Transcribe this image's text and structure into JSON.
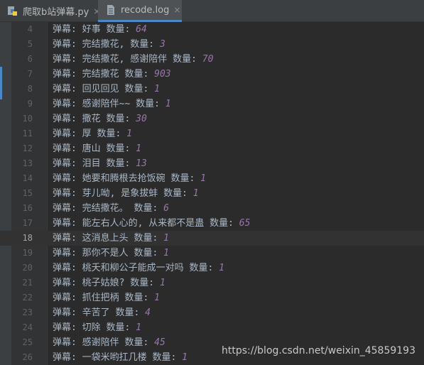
{
  "tabs": [
    {
      "label": "爬取b站弹幕.py",
      "icon": "python-file-icon",
      "active": false
    },
    {
      "label": "recode.log",
      "icon": "log-file-icon",
      "active": true
    }
  ],
  "close_glyph": "×",
  "current_line": "18",
  "lines": [
    {
      "num": "4",
      "text": "弹幕: 好事 数量: ",
      "count": "64"
    },
    {
      "num": "5",
      "text": "弹幕: 完结撒花, 数量: ",
      "count": "3"
    },
    {
      "num": "6",
      "text": "弹幕: 完结撒花, 感谢陪伴 数量: ",
      "count": "70"
    },
    {
      "num": "7",
      "text": "弹幕: 完结撒花 数量: ",
      "count": "903"
    },
    {
      "num": "8",
      "text": "弹幕: 回见回见 数量: ",
      "count": "1"
    },
    {
      "num": "9",
      "text": "弹幕: 感谢陪伴~~ 数量: ",
      "count": "1"
    },
    {
      "num": "10",
      "text": "弹幕: 撒花 数量: ",
      "count": "30"
    },
    {
      "num": "11",
      "text": "弹幕: 厚 数量: ",
      "count": "1"
    },
    {
      "num": "12",
      "text": "弹幕: 唐山 数量: ",
      "count": "1"
    },
    {
      "num": "13",
      "text": "弹幕: 泪目 数量: ",
      "count": "13"
    },
    {
      "num": "14",
      "text": "弹幕: 她要和腾根去抢饭碗 数量: ",
      "count": "1"
    },
    {
      "num": "15",
      "text": "弹幕: 芽儿呦, 是象拔蚌 数量: ",
      "count": "1"
    },
    {
      "num": "16",
      "text": "弹幕: 完结撒花。 数量: ",
      "count": "6"
    },
    {
      "num": "17",
      "text": "弹幕: 能左右人心的, 从来都不是蛊 数量: ",
      "count": "65"
    },
    {
      "num": "18",
      "text": "弹幕: 这消息上头 数量: ",
      "count": "1"
    },
    {
      "num": "19",
      "text": "弹幕: 那你不是人 数量: ",
      "count": "1"
    },
    {
      "num": "20",
      "text": "弹幕: 桃夭和柳公子能成一对吗 数量: ",
      "count": "1"
    },
    {
      "num": "21",
      "text": "弹幕: 桃子姑娘? 数量: ",
      "count": "1"
    },
    {
      "num": "22",
      "text": "弹幕: 抓住把柄 数量: ",
      "count": "1"
    },
    {
      "num": "23",
      "text": "弹幕: 辛苦了 数量: ",
      "count": "4"
    },
    {
      "num": "24",
      "text": "弹幕: 切除 数量: ",
      "count": "1"
    },
    {
      "num": "25",
      "text": "弹幕: 感谢陪伴 数量: ",
      "count": "45"
    },
    {
      "num": "26",
      "text": "弹幕: 一袋米哟扛几楼 数量: ",
      "count": "1"
    }
  ],
  "watermark": "https://blog.csdn.net/weixin_45859193",
  "colors": {
    "number": "#9876aa",
    "text": "#a9b7c6",
    "background": "#2b2b2b",
    "active_tab_underline": "#4a88c7"
  }
}
